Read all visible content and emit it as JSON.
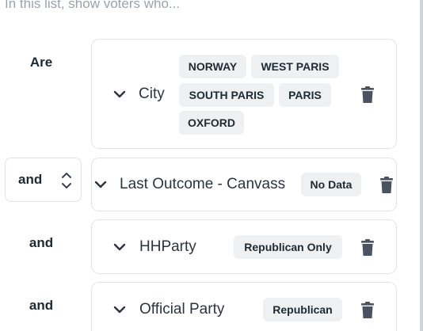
{
  "header": {
    "text": "In this list, show voters who..."
  },
  "rows": [
    {
      "label": "Are",
      "field": "City",
      "values": [
        "NORWAY",
        "WEST PARIS",
        "SOUTH PARIS",
        "PARIS",
        "OXFORD"
      ]
    },
    {
      "label": "and",
      "field": "Last Outcome - Canvass",
      "values": [
        "No Data"
      ]
    },
    {
      "label": "and",
      "field": "HHParty",
      "values": [
        "Republican Only"
      ]
    },
    {
      "label": "and",
      "field": "Official Party",
      "values": [
        "Republican"
      ]
    }
  ],
  "icons": {
    "expand": "chevron-down-icon",
    "remove": "trash-icon",
    "select": "updown-arrows-icon"
  },
  "colors": {
    "chip_bg": "#eef0f2",
    "border": "#e1e5ea",
    "placeholder_text": "#9aa3ad"
  }
}
